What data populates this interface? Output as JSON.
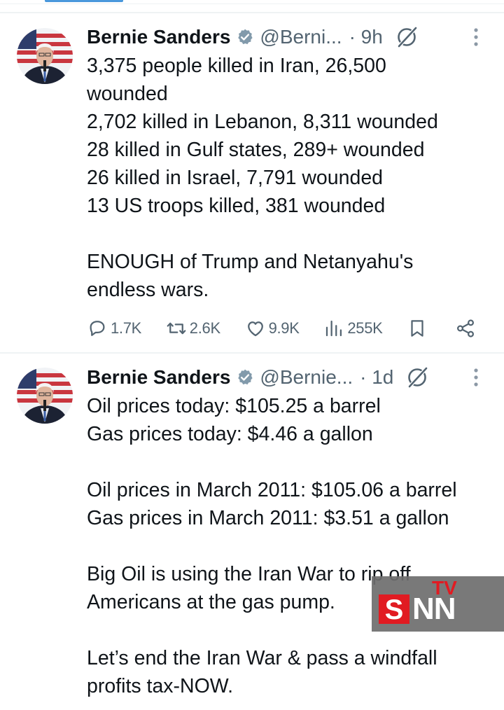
{
  "tweets": [
    {
      "author_name": "Bernie Sanders",
      "handle": "@Berni...",
      "time": "· 9h",
      "lines": [
        "3,375 people killed in Iran, 26,500",
        "wounded",
        "2,702 killed in Lebanon, 8,311 wounded",
        "28 killed in Gulf states, 289+ wounded",
        "26 killed in Israel, 7,791 wounded",
        "13 US troops killed, 381 wounded",
        "",
        "ENOUGH of Trump and Netanyahu's",
        "endless wars."
      ],
      "stats": {
        "replies": "1.7K",
        "reposts": "2.6K",
        "likes": "9.9K",
        "views": "255K"
      }
    },
    {
      "author_name": "Bernie Sanders",
      "handle": "@Bernie...",
      "time": "· 1d",
      "lines": [
        "Oil prices today: $105.25 a barrel",
        "Gas prices today: $4.46 a gallon",
        "",
        "Oil prices in March 2011: $105.06 a barrel",
        "Gas prices in March 2011: $3.51 a gallon",
        "",
        "Big Oil is using the Iran War to rip off",
        "Americans at the gas pump.",
        "",
        "Let’s end the Iran War & pass a windfall",
        "profits tax-NOW."
      ]
    }
  ],
  "icons": {
    "verified": "verified-badge-icon",
    "grok": "grok-icon",
    "more": "more-vertical-icon",
    "reply": "reply-icon",
    "repost": "repost-icon",
    "like": "like-icon",
    "views": "views-icon",
    "bookmark": "bookmark-icon",
    "share": "share-icon"
  },
  "colors": {
    "text": "#0f1419",
    "secondary": "#536471",
    "verified": "#829aab",
    "divider": "#eff3f4",
    "watermark_red": "#e11b22"
  },
  "watermark": {
    "s": "S",
    "nn": "NN",
    "tv": "TV"
  }
}
